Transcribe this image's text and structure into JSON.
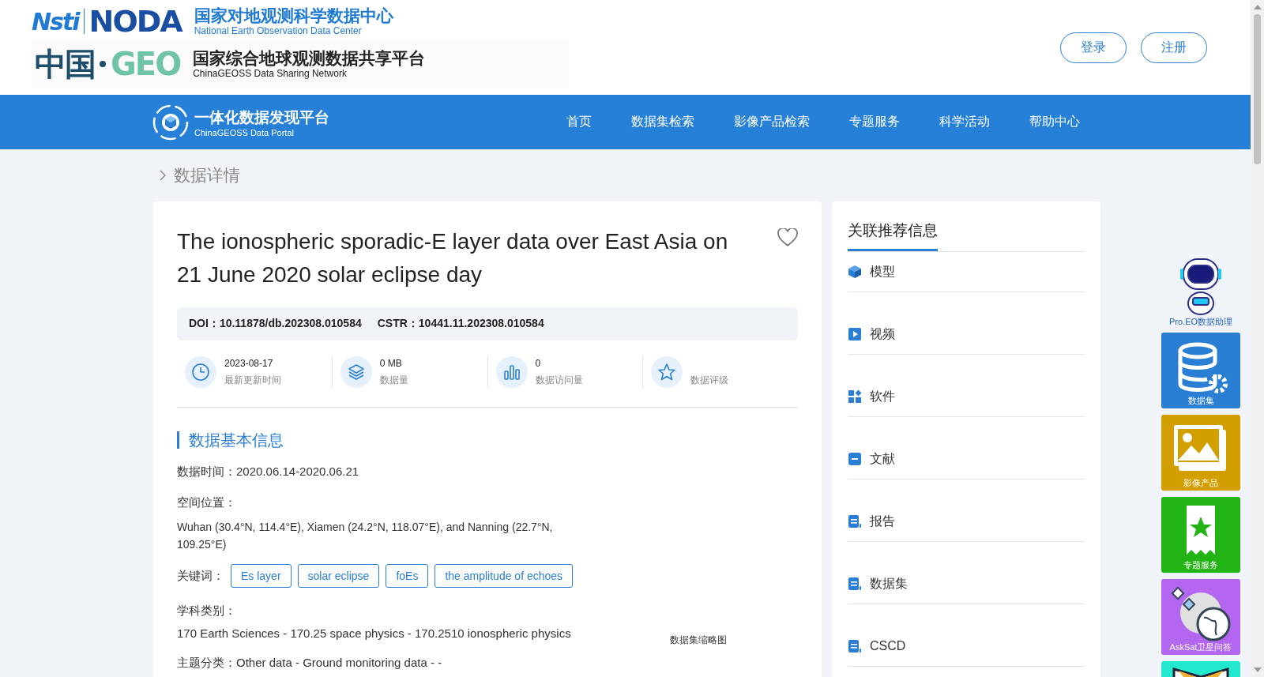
{
  "header": {
    "noda_logo": {
      "mark_1": "Nsti",
      "mark_2": "NODA",
      "title": "国家对地观测科学数据中心",
      "subtitle": "National Earth Observation Data Center"
    },
    "geo_logo": {
      "mark_1": "中国",
      "mark_2": "GEO",
      "title": "国家综合地球观测数据共享平台",
      "subtitle": "ChinaGEOSS Data Sharing Network"
    },
    "buttons": [
      "登录",
      "注册"
    ]
  },
  "nav": {
    "logo_title": "一体化数据发现平台",
    "logo_subtitle": "ChinaGEOSS Data Portal",
    "items": [
      {
        "label": "首页",
        "selected": false
      },
      {
        "label": "数据集检索",
        "selected": false
      },
      {
        "label": "影像产品检索",
        "selected": false
      },
      {
        "label": "专题服务",
        "selected": false
      },
      {
        "label": "科学活动",
        "selected": false
      },
      {
        "label": "帮助中心",
        "selected": false
      }
    ]
  },
  "breadcrumb": "数据详情",
  "dataset": {
    "title": "The ionospheric sporadic-E layer data over East Asia on 21 June 2020 solar eclipse day",
    "favorited": false,
    "ids": [
      {
        "label": "DOI：",
        "value": "10.11878/db.202308.010584"
      },
      {
        "label": "CSTR：",
        "value": "10441.11.202308.010584"
      }
    ],
    "stats": [
      {
        "kind": "clock",
        "value": "2023-08-17",
        "label": "最新更新时间"
      },
      {
        "kind": "layers",
        "value": "0 MB",
        "label": "数据量"
      },
      {
        "kind": "bars",
        "value": "0",
        "label": "数据访问量"
      },
      {
        "kind": "star",
        "label": "数据评级"
      }
    ],
    "section_title": "数据基本信息",
    "time_label": "数据时间：",
    "time_value": "2020.06.14-2020.06.21",
    "location_label": "空间位置：",
    "location_value": "Wuhan (30.4°N, 114.4°E), Xiamen (24.2°N, 118.07°E), and Nanning (22.7°N, 109.25°E)",
    "keywords_label": "关键词：",
    "keywords": [
      "Es layer",
      "solar eclipse",
      "foEs",
      "the amplitude of echoes"
    ],
    "subject_label": "学科类别：",
    "subject_value": "170 Earth Sciences - 170.25 space physics - 170.2510 ionospheric physics",
    "topic_label": "主题分类：",
    "topic_value": "Other data - Ground monitoring data - -",
    "thumbnail_caption": "数据集缩略图"
  },
  "related": {
    "title": "关联推荐信息",
    "items": [
      {
        "kind": "cube",
        "label": "模型"
      },
      {
        "kind": "play",
        "label": "视频"
      },
      {
        "kind": "grid",
        "label": "软件"
      },
      {
        "kind": "doc",
        "label": "文献"
      },
      {
        "kind": "scroll",
        "label": "报告"
      },
      {
        "kind": "scroll",
        "label": "数据集"
      },
      {
        "kind": "scroll",
        "label": "CSCD"
      }
    ]
  },
  "float_bar": {
    "assistant_label": "Pro.EO数据助理",
    "items": [
      {
        "kind": "database",
        "label": "数据集",
        "color": "#2a7fd4"
      },
      {
        "kind": "image",
        "label": "影像产品",
        "color": "#d39e00"
      },
      {
        "kind": "bookmark",
        "label": "专题服务",
        "color": "#22b314"
      },
      {
        "kind": "satellite",
        "label": "AskSat卫星问答",
        "color": "#b366f0"
      },
      {
        "kind": "book",
        "color": "#22e8d0"
      }
    ]
  }
}
